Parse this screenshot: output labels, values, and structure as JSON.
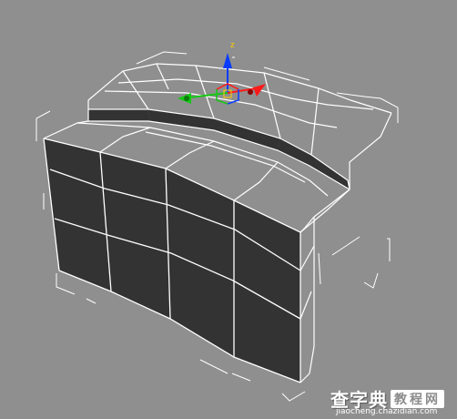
{
  "viewport": {
    "background": "#8f8f8f",
    "mesh_fill": "#333333",
    "edge_color": "#ffffff",
    "gizmo": {
      "axis_z_color": "#0a3cff",
      "axis_x_color": "#ff1a1a",
      "axis_y_color": "#14c814",
      "label_z": "z"
    }
  },
  "watermark": {
    "main": "查字典",
    "box": "教程网",
    "url": "jiaocheng.chazidian.com"
  }
}
